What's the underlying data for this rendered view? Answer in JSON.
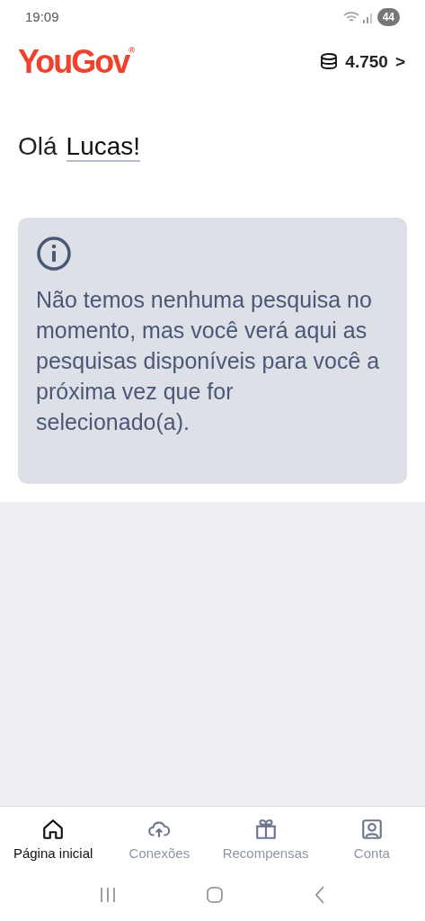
{
  "status_bar": {
    "time": "19:09",
    "battery": "44"
  },
  "header": {
    "logo": "YouGov",
    "logo_mark": "®",
    "points": "4.750",
    "chevron": ">"
  },
  "greeting": {
    "hello": "Olá",
    "name": "Lucas!"
  },
  "notice": {
    "text": "Não temos nenhuma pesquisa no momento, mas você verá aqui as pesquisas disponíveis para você a próxima vez que for selecionado(a)."
  },
  "tabs": [
    {
      "label": "Página inicial",
      "kind": "home",
      "selected": true
    },
    {
      "label": "Conexões",
      "kind": "cloud",
      "selected": false
    },
    {
      "label": "Recompensas",
      "kind": "gift",
      "selected": false
    },
    {
      "label": "Conta",
      "kind": "account",
      "selected": false
    }
  ]
}
